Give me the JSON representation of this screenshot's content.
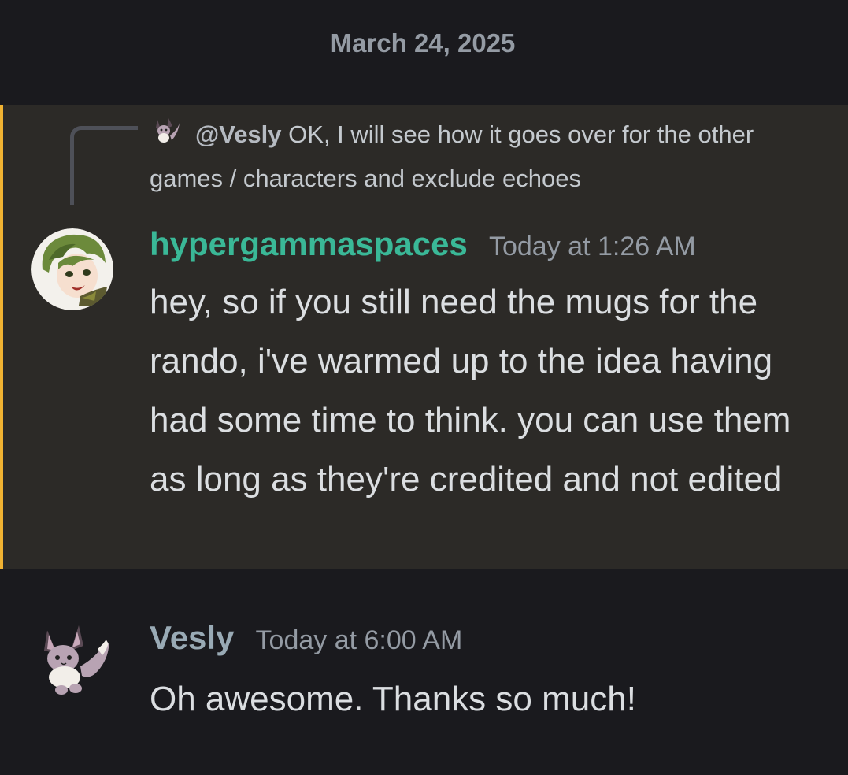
{
  "divider": {
    "date": "March 24, 2025"
  },
  "reply": {
    "mention": "@Vesly",
    "text": "OK, I will see how it goes over for the other games / characters and exclude echoes"
  },
  "messages": [
    {
      "username": "hypergammaspaces",
      "timestamp": "Today at 1:26 AM",
      "text": "hey, so if you still need the mugs for the rando, i've warmed up to the idea having had some time to think. you can use them as long as they're credited and not edited",
      "avatar": "anime-character-avatar",
      "username_color": "#3ab897",
      "highlighted": true,
      "highlight_color": "#f0b232"
    },
    {
      "username": "Vesly",
      "timestamp": "Today at 6:00 AM",
      "text": "Oh awesome. Thanks so much!",
      "avatar": "eevee-avatar",
      "username_color": "#99aab5"
    }
  ]
}
